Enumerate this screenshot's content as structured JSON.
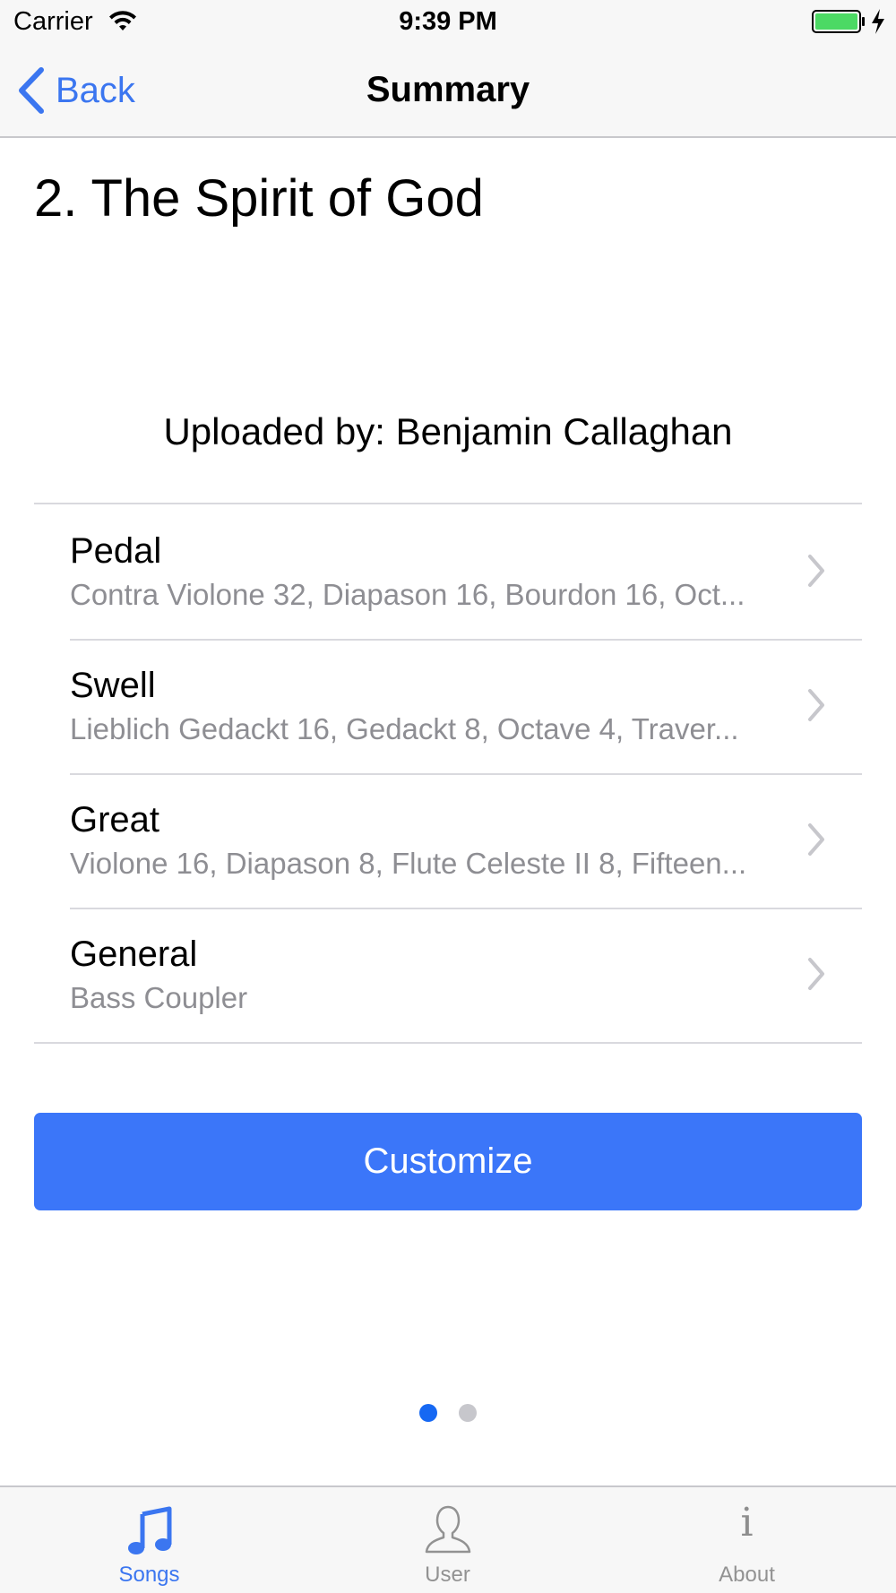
{
  "status_bar": {
    "carrier": "Carrier",
    "time": "9:39 PM",
    "battery_color": "#4cd964"
  },
  "nav": {
    "back_label": "Back",
    "title": "Summary"
  },
  "song": {
    "title": "2. The Spirit of God",
    "uploaded_by": "Uploaded by: Benjamin Callaghan"
  },
  "divisions": [
    {
      "name": "Pedal",
      "stops": "Contra Violone 32, Diapason 16, Bourdon 16, Oct..."
    },
    {
      "name": "Swell",
      "stops": "Lieblich Gedackt 16, Gedackt 8, Octave 4, Traver..."
    },
    {
      "name": "Great",
      "stops": "Violone 16, Diapason 8, Flute Celeste II 8, Fifteen..."
    },
    {
      "name": "General",
      "stops": "Bass Coupler"
    }
  ],
  "actions": {
    "customize_label": "Customize"
  },
  "pager": {
    "total_pages": 2,
    "current_page": 1
  },
  "tab_bar": {
    "items": [
      {
        "label": "Songs",
        "icon": "music-note-icon",
        "selected": true
      },
      {
        "label": "User",
        "icon": "user-icon",
        "selected": false
      },
      {
        "label": "About",
        "icon": "info-icon",
        "selected": false
      }
    ]
  },
  "colors": {
    "accent": "#3b76f0",
    "button": "#3b76f9",
    "secondary_text": "#8e8e93",
    "separator": "#d9d9de"
  }
}
